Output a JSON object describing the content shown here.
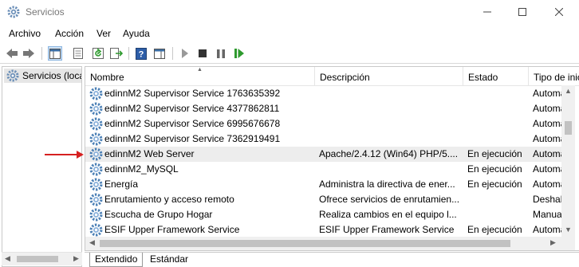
{
  "window": {
    "title": "Servicios",
    "minimize_glyph": "—",
    "maximize_glyph": "☐",
    "close_glyph": "✕"
  },
  "menu": [
    "Archivo",
    "Acción",
    "Ver",
    "Ayuda"
  ],
  "toolbar": {
    "icons": [
      "back-icon",
      "forward-icon",
      "show-tree-icon",
      "properties-icon",
      "refresh-icon",
      "export-icon",
      "help-icon",
      "show-pane-icon",
      "start-icon",
      "stop-icon",
      "pause-icon",
      "resume-icon"
    ]
  },
  "tree": {
    "selected_label": "Servicios (locales)"
  },
  "table": {
    "columns": [
      "Nombre",
      "Descripción",
      "Estado",
      "Tipo de inicio"
    ],
    "rows": [
      {
        "name": "edinnM2 Supervisor Service 1763635392",
        "description": "",
        "state": "",
        "type": "Automático"
      },
      {
        "name": "edinnM2 Supervisor Service 4377862811",
        "description": "",
        "state": "",
        "type": "Automático"
      },
      {
        "name": "edinnM2 Supervisor Service 6995676678",
        "description": "",
        "state": "",
        "type": "Automático"
      },
      {
        "name": "edinnM2 Supervisor Service 7362919491",
        "description": "",
        "state": "",
        "type": "Automático"
      },
      {
        "name": "edinnM2 Web Server",
        "description": "Apache/2.4.12 (Win64) PHP/5....",
        "state": "En ejecución",
        "type": "Automático"
      },
      {
        "name": "edinnM2_MySQL",
        "description": "",
        "state": "En ejecución",
        "type": "Automático"
      },
      {
        "name": "Energía",
        "description": "Administra la directiva de ener...",
        "state": "En ejecución",
        "type": "Automático"
      },
      {
        "name": "Enrutamiento y acceso remoto",
        "description": "Ofrece servicios de enrutamien...",
        "state": "",
        "type": "Deshabilitado"
      },
      {
        "name": "Escucha de Grupo Hogar",
        "description": "Realiza cambios en el equipo l...",
        "state": "",
        "type": "Manual"
      },
      {
        "name": "ESIF Upper Framework Service",
        "description": "ESIF Upper Framework Service",
        "state": "En ejecución",
        "type": "Automático"
      }
    ],
    "highlighted_row": 4
  },
  "tabs": [
    "Extendido",
    "Estándar"
  ],
  "colors": {
    "arrow": "#d62020",
    "gear": "#4a7fb5",
    "highlight": "#ededed"
  }
}
